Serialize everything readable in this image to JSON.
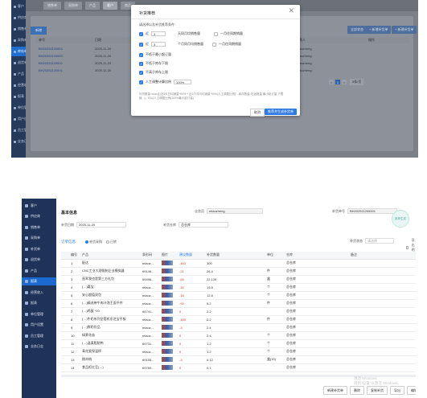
{
  "panel1": {
    "sidebar": [
      "客户",
      "供应商",
      "销售单",
      "采购单",
      "库存单",
      "退货单",
      "产品",
      "经营收入",
      "报表",
      "单位管理",
      "用户设置",
      "员工管理",
      "业务日志"
    ],
    "sidebar_active_index": 4,
    "top_tabs": [
      "销售单",
      "采购单",
      "产品",
      "客户",
      "商品"
    ],
    "top_active_index": 3,
    "bg_left_button": "新增",
    "bg_right_buttons": [
      "全部状态",
      "+ 新增补货单",
      "+ 新建补货单"
    ],
    "bg_table": {
      "headers": [
        "单号",
        "日期",
        "",
        "",
        "负责人",
        "操作"
      ],
      "rows": [
        [
          "BH20251120004",
          "2025-11-20",
          "",
          "",
          "miaozheng",
          ""
        ],
        [
          "BH20251120003",
          "2025-11-20",
          "",
          "",
          "miaozheng",
          ""
        ],
        [
          "BH20251120002",
          "2025-11-20",
          "",
          "",
          "miaozheng",
          ""
        ],
        [
          "BH20251120001",
          "2025-11-20",
          "",
          "",
          "miaozheng",
          ""
        ]
      ]
    },
    "pager": [
      "<",
      "1",
      ">",
      "5条/页"
    ],
    "dialog": {
      "title": "补货推荐",
      "close_glyph": "✕",
      "prompt": "请选择以及补货推荐条件：",
      "cond1": {
        "prefix": "近",
        "value": "3",
        "label": "天同月均销售量",
        "alt": "一月往同期销量"
      },
      "cond2": {
        "prefix": "近",
        "value": "3",
        "label": "个月同月均销售量",
        "alt": "一月往同期销量"
      },
      "cond3": "不低于最小起订量",
      "cond4": "不低于库存下限",
      "cond5": "不高于库存上限",
      "cond6": {
        "label": "人工调整计算比例",
        "value": "100%"
      },
      "note": "补货数量=max(【(近3天日均销量*90% + 近3个月月均销量*90%)人工调整比例】-库存数量-在途数量,最小起订量,下限值...)；均以人工调整比例(100%最小起订量)",
      "cancel": "取消",
      "ok": "推荐并生成补货单"
    }
  },
  "panel2": {
    "sidebar": [
      "客户",
      "供应商",
      "销售单",
      "采购单",
      "补货单",
      "退货单",
      "产品",
      "报表",
      "经营收入",
      "报表",
      "单位管理",
      "用户设置",
      "员工管理",
      "业务日志"
    ],
    "sidebar_active_index": 7,
    "section_title": "基本信息",
    "owner_label": "业务员",
    "owner_value": "miaozheng",
    "docno_label": "补货单号",
    "docno_value": "BH202511200001",
    "date_label": "补货日期",
    "date_value": "2025-11-20",
    "warehouse_label": "补货仓库",
    "warehouse_value": "总仓库",
    "badge": "推荐生成",
    "sub_title": "订单信息",
    "tab_recommend": "补货采购",
    "tab_sales": "已转",
    "filter_label": "补货状态",
    "filter_placeholder": "请选择",
    "filter_check": "导出明细",
    "table": {
      "headers": [
        "",
        "编号",
        "产品",
        "条形码",
        "图片",
        "建议数量",
        "补货数量",
        "单位",
        "仓库",
        "备注"
      ],
      "rows": [
        [
          "1",
          "配达",
          "miaoz...",
          "",
          "-463",
          "300",
          "",
          "总仓库",
          ""
        ],
        [
          "2",
          "CNC工业大理限制企业模拟器",
          "69146...",
          "",
          "-21",
          "26.4",
          "件",
          "总仓库",
          ""
        ],
        [
          "3",
          "直率我也是第三方礼包",
          "69496...",
          "",
          "-65",
          "22.139",
          "盒",
          "总仓库",
          ""
        ],
        [
          "4",
          "(…)嘉宝",
          "miaoz...",
          "",
          "-16",
          "19.8",
          "个",
          "总仓库",
          ""
        ],
        [
          "5",
          "安心超值双包",
          "miaoz...",
          "",
          "-18",
          "12.8",
          "个",
          "总仓库",
          ""
        ],
        [
          "6",
          "(…)精选带牛肉汁泡王面平件",
          "miaoz...",
          "",
          "-92",
          "5.2",
          "件",
          "总仓库",
          ""
        ],
        [
          "7",
          "(…)鸡蛋 *10",
          "64741...",
          "",
          "0",
          "2.2",
          "",
          "总仓库",
          ""
        ],
        [
          "8",
          "(…)牛奶系列全套机东芝宝平板",
          "miaoz...",
          "",
          "-189",
          "2.2",
          "件",
          "总仓库",
          ""
        ],
        [
          "9",
          "(…)鲜奶饮品",
          "miaoz...",
          "",
          "-3",
          "2.4",
          "",
          "总仓库",
          ""
        ],
        [
          "10",
          "绿萝花苗",
          "miaoz...",
          "",
          "0",
          "2.4",
          "个",
          "总仓库",
          ""
        ],
        [
          "11",
          "(…)温柔脂肪鸭",
          "69731...",
          "",
          "0",
          "1.2",
          "个",
          "总仓库",
          ""
        ],
        [
          "12",
          "青花瓷保温杯",
          "miaoz...",
          "",
          "0",
          "1.2",
          "个",
          "总仓库",
          ""
        ],
        [
          "13",
          "桃木梳",
          "69155...",
          "",
          "-3",
          "0.12",
          "盒(10)",
          "总仓库",
          ""
        ],
        [
          "14",
          "食品柜红豆(…)",
          "69780...",
          "",
          "0",
          "0.1",
          "",
          "总仓库",
          ""
        ]
      ]
    },
    "watermark": "激活 Windows\n转到\"设置\"以激活 Windows。",
    "footer_buttons": [
      "新建补货单",
      "删除",
      "复制补货",
      "导出",
      "编辑",
      "打印(P)"
    ]
  },
  "colors": {
    "accent": "#2e7be6",
    "sidebar_dark": "#1f3358",
    "negative": "#e0392b"
  }
}
